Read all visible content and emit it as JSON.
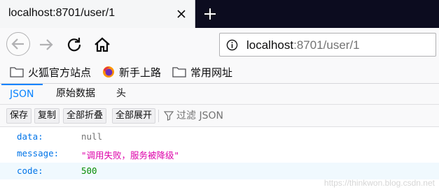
{
  "tab": {
    "title": "localhost:8701/user/1"
  },
  "url": {
    "host": "localhost",
    "rest": ":8701/user/1"
  },
  "bookmarks": [
    {
      "label": "火狐官方站点",
      "icon": "folder-icon"
    },
    {
      "label": "新手上路",
      "icon": "firefox-icon"
    },
    {
      "label": "常用网址",
      "icon": "folder-icon"
    }
  ],
  "viewer_tabs": [
    "JSON",
    "原始数据",
    "头"
  ],
  "toolbar": {
    "save": "保存",
    "copy": "复制",
    "collapse_all": "全部折叠",
    "expand_all": "全部展开",
    "filter_placeholder": "过滤 JSON"
  },
  "json_rows": [
    {
      "key": "data:",
      "value": "null"
    },
    {
      "key": "message:",
      "value": "\"调用失败，服务被降级\""
    },
    {
      "key": "code:",
      "value": "500"
    }
  ],
  "watermark": "https://thinkwon.blog.csdn.net",
  "colors": {
    "accent": "#0a84ff",
    "tabstrip": "#0c0c1f"
  }
}
